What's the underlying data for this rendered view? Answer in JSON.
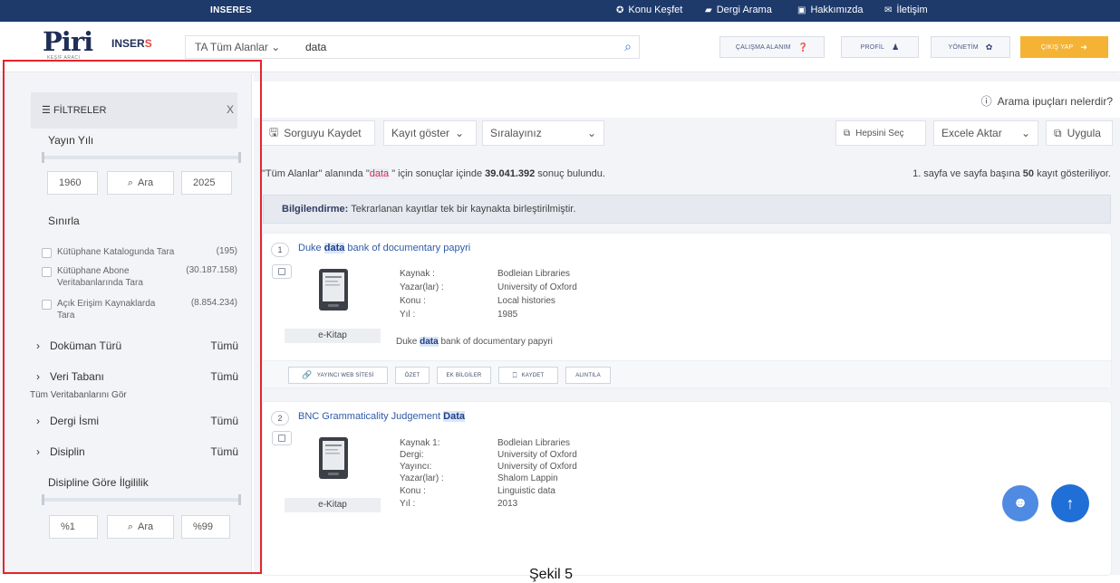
{
  "topbar": {
    "brand": "INSERES",
    "nav": [
      {
        "icon": "compass-icon",
        "glyph": "✪",
        "label": "Konu Keşfet"
      },
      {
        "icon": "book-icon",
        "glyph": "▰",
        "label": "Dergi Arama"
      },
      {
        "icon": "id-card-icon",
        "glyph": "▣",
        "label": "Hakkımızda"
      },
      {
        "icon": "envelope-icon",
        "glyph": "✉",
        "label": "İletişim"
      }
    ]
  },
  "header": {
    "logo_text": "Piri",
    "logo_sub": "KEŞİF ARACI",
    "inseris_text": "INSER",
    "inseris_accent": "S",
    "search": {
      "field": "TA Tüm Alanlar",
      "query": "data"
    },
    "buttons": {
      "workspace": "ÇALIŞMA ALANIM",
      "profile": "PROFİL",
      "admin": "YÖNETİM",
      "logout": "ÇIKIŞ YAP"
    }
  },
  "sidebar": {
    "title": "FİLTRELER",
    "close": "X",
    "year_label": "Yayın Yılı",
    "year_from": "1960",
    "year_to": "2025",
    "search_label": "Ara",
    "limit_label": "Sınırla",
    "limits": [
      {
        "label": "Kütüphane Katalogunda Tara",
        "count": "(195)"
      },
      {
        "label": "Kütüphane Abone Veritabanlarında Tara",
        "count": "(30.187.158)"
      },
      {
        "label": "Açık Erişim Kaynaklarda Tara",
        "count": "(8.854.234)"
      }
    ],
    "facets": [
      {
        "label": "Doküman Türü",
        "value": "Tümü"
      },
      {
        "label": "Veri Tabanı",
        "value": "Tümü"
      },
      {
        "label": "Dergi İsmi",
        "value": "Tümü"
      },
      {
        "label": "Disiplin",
        "value": "Tümü"
      }
    ],
    "all_databases_link": "Tüm Veritabanlarını Gör",
    "relevance_label": "Disipline Göre İlgililik",
    "rel_from": "%1",
    "rel_to": "%99"
  },
  "main": {
    "tips": "Arama ipuçları nelerdir?",
    "toolbar": {
      "save_query": "Sorguyu Kaydet",
      "show_records": "Kayıt göster",
      "sort": "Sıralayınız",
      "select_all": "Hepsini Seç",
      "export": "Excele Aktar",
      "apply": "Uygula"
    },
    "results_prefix": "\"Tüm Alanlar\" alanında \"",
    "results_term": "data",
    "results_mid": " \" için sonuçlar içinde ",
    "results_count": "39.041.392",
    "results_suffix": " sonuç bulundu.",
    "page_prefix": "1. sayfa ve sayfa başına ",
    "page_size": "50",
    "page_suffix": " kayıt gösteriliyor.",
    "notice_bold": "Bilgilendirme:",
    "notice_text": " Tekrarlanan kayıtlar tek bir kaynakta birleştirilmiştir.",
    "results": [
      {
        "num": "1",
        "title_pre": "Duke ",
        "title_kw": "data",
        "title_post": " bank of documentary papyri",
        "type": "e-Kitap",
        "meta": [
          {
            "k": "Kaynak :",
            "v": "Bodleian Libraries"
          },
          {
            "k": "Yazar(lar) :",
            "v": "University of Oxford"
          },
          {
            "k": "Konu :",
            "v": "Local histories"
          },
          {
            "k": "Yıl :",
            "v": "1985"
          }
        ],
        "desc_pre": "Duke ",
        "desc_kw": "data",
        "desc_post": " bank of documentary papyri",
        "actions": [
          "YAYINCI WEB SİTESİ",
          "ÖZET",
          "EK BİLGİLER",
          "KAYDET",
          "ALINTILA"
        ]
      },
      {
        "num": "2",
        "title_pre": "BNC Grammaticality Judgement ",
        "title_kw": "Data",
        "title_post": "",
        "type": "e-Kitap",
        "meta": [
          {
            "k": "Kaynak 1:",
            "v": "Bodleian Libraries"
          },
          {
            "k": "Dergi:",
            "v": "University of Oxford"
          },
          {
            "k": "Yayıncı:",
            "v": "University of Oxford"
          },
          {
            "k": "Yazar(lar) :",
            "v": "Shalom Lappin"
          },
          {
            "k": "Konu :",
            "v": "Linguistic data"
          },
          {
            "k": "Yıl :",
            "v": "2013"
          }
        ]
      }
    ]
  },
  "caption": "Şekil 5"
}
